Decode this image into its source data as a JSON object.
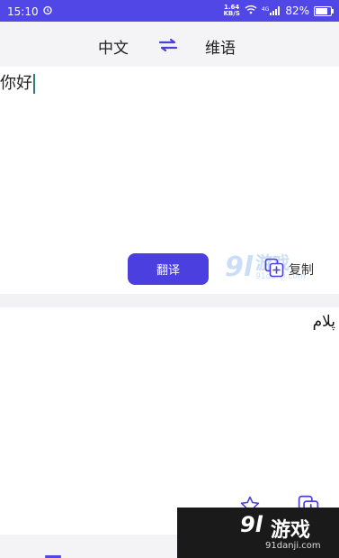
{
  "status_bar": {
    "time": "15:10",
    "net_speed_value": "1.64",
    "net_speed_unit": "KB/S",
    "signal_label": "4G",
    "battery_text": "82%",
    "battery_level": 0.82
  },
  "header": {
    "source_language": "中文",
    "target_language": "维语",
    "swap_icon": "swap-arrows-icon"
  },
  "input": {
    "text": "你好"
  },
  "actions": {
    "translate_label": "翻译",
    "copy_label": "复制"
  },
  "output": {
    "text": "پلام"
  },
  "watermark": {
    "number": "9l",
    "name": "游戏",
    "url": "91danji.com"
  },
  "colors": {
    "accent": "#4b3fe0",
    "status_bar": "#5146e6",
    "panel_background": "#f4f4f6"
  }
}
